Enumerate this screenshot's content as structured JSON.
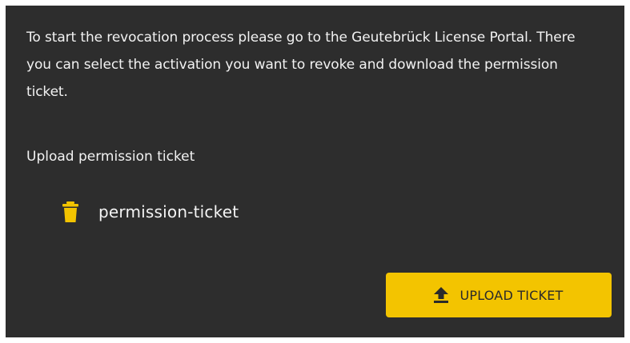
{
  "dialog": {
    "intro_text": "To start the revocation process please go to the Geutebrück License Portal. There you can select the activation you want to revoke and download the permission ticket.",
    "upload_section_label": "Upload permission ticket",
    "file": {
      "name": "permission-ticket",
      "remove_icon": "trash-icon"
    },
    "upload_button": {
      "label": "UPLOAD TICKET",
      "icon": "upload-icon"
    }
  },
  "colors": {
    "panel_background": "#2d2d2d",
    "text": "#f2f2f2",
    "accent": "#f3c400"
  }
}
